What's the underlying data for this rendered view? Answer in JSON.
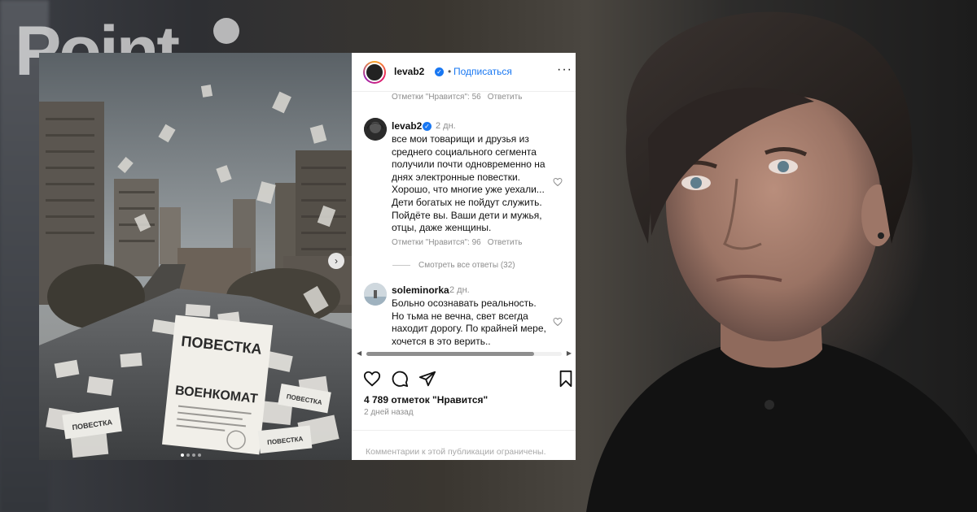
{
  "brand": {
    "logo_text": "Point"
  },
  "post": {
    "image_papers": {
      "headline_1": "ПОВЕСТКА",
      "headline_2": "ВОЕНКОМАТ",
      "small_1": "ПОВЕСТКА",
      "small_2": "ПОВЕСТКА",
      "small_3": "ПОВЕСТКА"
    }
  },
  "header": {
    "username": "levab2",
    "separator": "•",
    "follow_label": "Подписаться",
    "more_label": "···"
  },
  "comments": [
    {
      "likes_label": "Отметки \"Нравится\": 56",
      "reply_label": "Ответить"
    },
    {
      "username": "levab2",
      "time": "2 дн.",
      "lines": [
        "все мои товарищи и друзья из",
        "среднего социального сегмента",
        "получили почти одновременно на",
        "днях электронные повестки.",
        "Хорошо, что многие уже уехали...",
        "Дети богатых не пойдут служить.",
        "Пойдёте вы. Ваши дети и мужья,",
        "отцы, даже женщины."
      ],
      "likes_label": "Отметки \"Нравится\": 96",
      "reply_label": "Ответить"
    },
    {
      "username": "soleminorka",
      "time": "2 дн.",
      "lines": [
        "Больно осознавать реальность.",
        "Но тьма не вечна, свет всегда",
        "находит дорогу. По крайней мере,",
        "хочется в это верить.."
      ]
    }
  ],
  "view_replies_label": "Смотреть все ответы (32)",
  "footer": {
    "likes_count_label": "4 789 отметок \"Нравится\"",
    "posted_label": "2 дней назад",
    "comments_limited_label": "Комментарии к этой публикации ограничены."
  },
  "colors": {
    "accent": "#1877f2",
    "muted_text": "#8e8e8e"
  }
}
